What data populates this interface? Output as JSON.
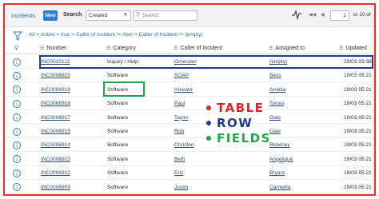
{
  "toolbar": {
    "title": "Incidents",
    "new_label": "New",
    "search_label": "Search",
    "search_field_value": "Created",
    "search_placeholder": "Search",
    "page_current": "1",
    "page_range": "to 10 of"
  },
  "breadcrumb": [
    "All",
    "Active = true",
    "Caller of Incident != Abel",
    "Caller of Incident != (empty)"
  ],
  "columns": {
    "number": "Number",
    "category": "Category",
    "caller": "Caller of Incident",
    "assigned": "Assigned to",
    "date": "Updated"
  },
  "rows": [
    {
      "number": "INC0010112",
      "category": "Inquiry / Help",
      "caller": "Omender",
      "assigned": "(empty)",
      "date": "23/03 03:38"
    },
    {
      "number": "INC0006920",
      "category": "Software",
      "caller": "SOAP",
      "assigned": "Bess",
      "date": "19/03 05:21"
    },
    {
      "number": "INC0006919",
      "category": "Software",
      "caller": "Howard",
      "assigned": "Amelia",
      "date": "19/03 05:21"
    },
    {
      "number": "INC0006918",
      "category": "Software",
      "caller": "Paul",
      "assigned": "Torres",
      "date": "19/03 05:21"
    },
    {
      "number": "INC0006917",
      "category": "Software",
      "caller": "Taylor",
      "assigned": "Gale",
      "date": "19/03 05:21"
    },
    {
      "number": "INC0006915",
      "category": "Software",
      "caller": "Rob",
      "assigned": "Gale",
      "date": "19/03 05:21"
    },
    {
      "number": "INC0006914",
      "category": "Software",
      "caller": "Christen",
      "assigned": "Beverley",
      "date": "19/03 05:21"
    },
    {
      "number": "INC0006913",
      "category": "Software",
      "caller": "Beth",
      "assigned": "Angelique",
      "date": "19/03 05:21"
    },
    {
      "number": "INC0006912",
      "category": "Software",
      "caller": "Eric",
      "assigned": "Bryant",
      "date": "19/03 05:21"
    },
    {
      "number": "INC0006909",
      "category": "Software",
      "caller": "Justin",
      "assigned": "Carmella",
      "date": "19/03 05:21"
    }
  ],
  "overlay": {
    "items": [
      {
        "text": "TABLE",
        "color": "#e0262c"
      },
      {
        "text": "ROW",
        "color": "#1f3c8c"
      },
      {
        "text": "FIELDS",
        "color": "#21a84a"
      }
    ]
  },
  "colors": {
    "frame": "#e8302a",
    "row_highlight": "#1f3c8c",
    "field_highlight": "#21a84a",
    "link": "#2e6fb0",
    "new_button": "#2f7dd4"
  },
  "icons": [
    "hamburger-icon",
    "filter-icon",
    "activity-icon",
    "search-icon",
    "info-icon",
    "first-page-icon",
    "prev-page-icon"
  ]
}
